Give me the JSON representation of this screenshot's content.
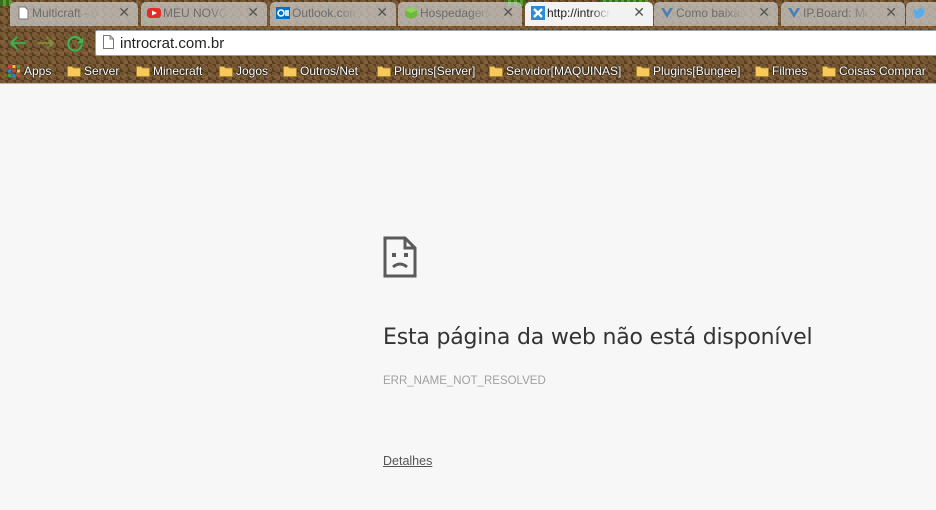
{
  "tabs": [
    {
      "title": "Multicraft - c",
      "icon": "page-icon",
      "active": false
    },
    {
      "title": "MEU NOVO",
      "icon": "youtube-icon",
      "active": false
    },
    {
      "title": "Outlook.com",
      "icon": "outlook-icon",
      "active": false
    },
    {
      "title": "Hospedagem",
      "icon": "hosting-icon",
      "active": false
    },
    {
      "title": "http://introcr",
      "icon": "x-icon",
      "active": true
    },
    {
      "title": "Como baixar",
      "icon": "ipboard-icon",
      "active": false
    },
    {
      "title": "IP.Board: Ma",
      "icon": "ipboard-icon",
      "active": false
    },
    {
      "title": "",
      "icon": "twitter-icon",
      "active": false
    }
  ],
  "toolbar": {
    "address_value": "introcrat.com.br"
  },
  "bookmarks": [
    {
      "label": "Apps",
      "icon": "apps-grid-icon"
    },
    {
      "label": "Server",
      "icon": "folder-icon"
    },
    {
      "label": "Minecraft",
      "icon": "folder-icon"
    },
    {
      "label": "Jogos",
      "icon": "folder-icon"
    },
    {
      "label": "Outros/Net",
      "icon": "folder-icon"
    },
    {
      "label": "Plugins[Server]",
      "icon": "folder-icon"
    },
    {
      "label": "Servidor[MAQUINAS]",
      "icon": "folder-icon"
    },
    {
      "label": "Plugins[Bungee]",
      "icon": "folder-icon"
    },
    {
      "label": "Filmes",
      "icon": "folder-icon"
    },
    {
      "label": "Coisas Comprar",
      "icon": "folder-icon"
    }
  ],
  "error": {
    "title": "Esta página da web não está disponível",
    "code": "ERR_NAME_NOT_RESOLVED",
    "details_label": "Detalhes"
  },
  "colors": {
    "page_background": "#f7f7f7",
    "title_text": "#333333",
    "code_text": "#a0a0a0",
    "nav_green": "#4caf50",
    "youtube_red": "#e52d27",
    "outlook_blue": "#0072c6",
    "twitter_blue": "#55acee"
  }
}
